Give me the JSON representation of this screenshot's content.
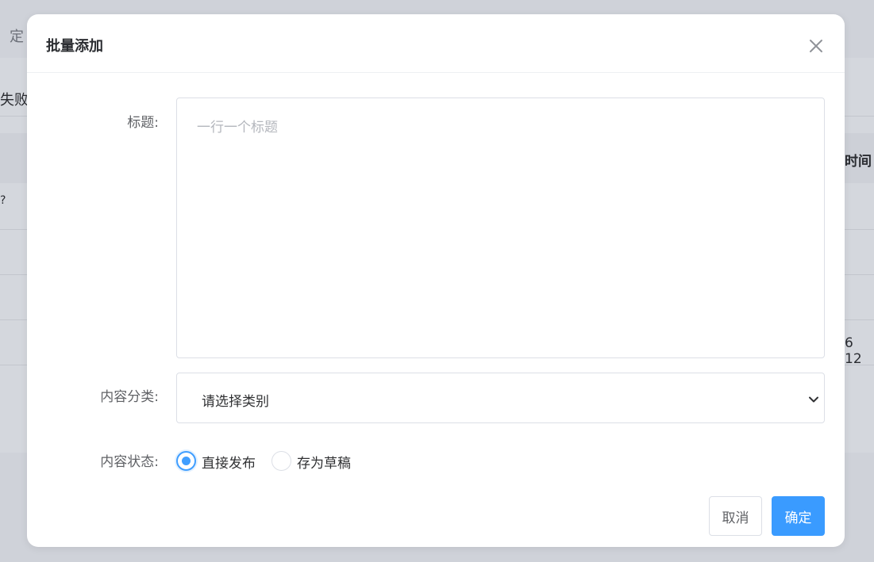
{
  "background": {
    "top_text": "定",
    "fail_text": "失败",
    "time_column_fragment": "时间",
    "question_fragment": "?",
    "number_fragment": "6 12"
  },
  "dialog": {
    "title": "批量添加",
    "close_icon": "close-icon",
    "fields": {
      "title_label": "标题:",
      "title_placeholder": "一行一个标题",
      "title_value": "",
      "category_label": "内容分类:",
      "category_selected": "请选择类别",
      "status_label": "内容状态:"
    },
    "status_options": [
      {
        "label": "直接发布",
        "checked": true
      },
      {
        "label": "存为草稿",
        "checked": false
      }
    ],
    "buttons": {
      "cancel": "取消",
      "confirm": "确定"
    }
  },
  "colors": {
    "primary": "#409eff",
    "overlay": "#cfd2d9",
    "border": "#dcdfe6"
  }
}
